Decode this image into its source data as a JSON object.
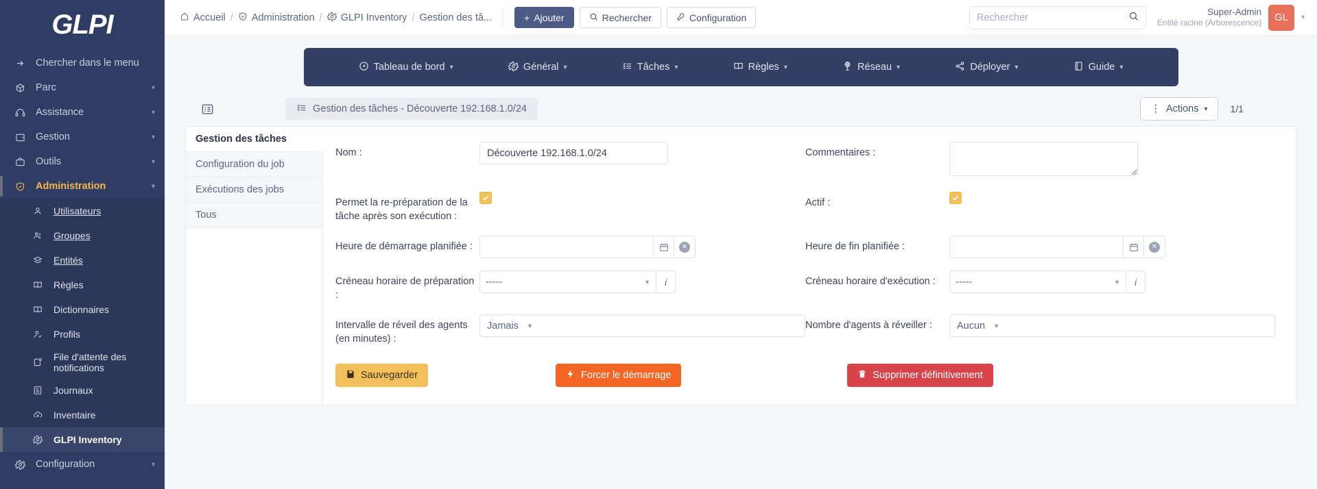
{
  "sidebar": {
    "logo": "GLPI",
    "search_menu": "Chercher dans le menu",
    "items": [
      {
        "label": "Parc",
        "icon": "box-icon"
      },
      {
        "label": "Assistance",
        "icon": "headset-icon"
      },
      {
        "label": "Gestion",
        "icon": "wallet-icon"
      },
      {
        "label": "Outils",
        "icon": "briefcase-icon"
      },
      {
        "label": "Administration",
        "icon": "shield-icon"
      }
    ],
    "admin_sub": [
      {
        "label": "Utilisateurs",
        "icon": "user-icon"
      },
      {
        "label": "Groupes",
        "icon": "users-icon"
      },
      {
        "label": "Entités",
        "icon": "layers-icon"
      },
      {
        "label": "Règles",
        "icon": "book-icon"
      },
      {
        "label": "Dictionnaires",
        "icon": "book-icon"
      },
      {
        "label": "Profils",
        "icon": "user-check-icon"
      },
      {
        "label": "File d'attente des notifications",
        "icon": "bell-notify-icon"
      },
      {
        "label": "Journaux",
        "icon": "journal-icon"
      },
      {
        "label": "Inventaire",
        "icon": "cloud-download-icon"
      },
      {
        "label": "GLPI Inventory",
        "icon": "gear-icon"
      }
    ],
    "configuration": {
      "label": "Configuration",
      "icon": "gear-icon"
    }
  },
  "topbar": {
    "breadcrumbs": [
      {
        "label": "Accueil",
        "icon": "home-icon"
      },
      {
        "label": "Administration",
        "icon": "shield-icon"
      },
      {
        "label": "GLPI Inventory",
        "icon": "gear-icon"
      },
      {
        "label": "Gestion des tâ...",
        "icon": ""
      }
    ],
    "add_button": "Ajouter",
    "search_button": "Rechercher",
    "config_button": "Configuration",
    "search": {
      "placeholder": "Rechercher",
      "value": ""
    },
    "user": {
      "name": "Super-Admin",
      "entity": "Entité racine (Arborescence)",
      "initials": "GL"
    }
  },
  "nav": {
    "items": [
      {
        "label": "Tableau de bord",
        "icon": "dashboard-icon"
      },
      {
        "label": "Général",
        "icon": "gear-icon"
      },
      {
        "label": "Tâches",
        "icon": "tasks-icon"
      },
      {
        "label": "Règles",
        "icon": "book-icon"
      },
      {
        "label": "Réseau",
        "icon": "network-icon"
      },
      {
        "label": "Déployer",
        "icon": "share-icon"
      },
      {
        "label": "Guide",
        "icon": "book-closed-icon"
      }
    ]
  },
  "page": {
    "title": "Gestion des tâches - Découverte 192.168.1.0/24",
    "actions_label": "Actions",
    "pager": "1/1"
  },
  "tabs": [
    {
      "label": "Gestion des tâches",
      "active": true
    },
    {
      "label": "Configuration du job",
      "active": false
    },
    {
      "label": "Exécutions des jobs",
      "active": false
    },
    {
      "label": "Tous",
      "active": false
    }
  ],
  "form": {
    "nom": {
      "label": "Nom :",
      "value": "Découverte 192.168.1.0/24"
    },
    "commentaires": {
      "label": "Commentaires :",
      "value": ""
    },
    "repreparation": {
      "label": "Permet la re-préparation de la tâche après son exécution :",
      "checked": true
    },
    "actif": {
      "label": "Actif :",
      "checked": true
    },
    "heure_demarrage": {
      "label": "Heure de démarrage planifiée :",
      "value": ""
    },
    "heure_fin": {
      "label": "Heure de fin planifiée :",
      "value": ""
    },
    "creneau_preparation": {
      "label": "Créneau horaire de préparation :",
      "value": "-----"
    },
    "creneau_execution": {
      "label": "Créneau horaire d'exécution :",
      "value": "-----"
    },
    "intervalle_reveil": {
      "label": "Intervalle de réveil des agents (en minutes) :",
      "value": "Jamais"
    },
    "nombre_agents": {
      "label": "Nombre d'agents à réveiller :",
      "value": "Aucun"
    }
  },
  "buttons": {
    "save": "Sauvegarder",
    "force": "Forcer le démarrage",
    "delete": "Supprimer définitivement"
  },
  "colors": {
    "sidebar": "#2f3c63",
    "nav": "#343f64",
    "accent_amber": "#f3c05c",
    "orange": "#f26522",
    "red": "#d9434a",
    "avatar": "#e8705a"
  }
}
